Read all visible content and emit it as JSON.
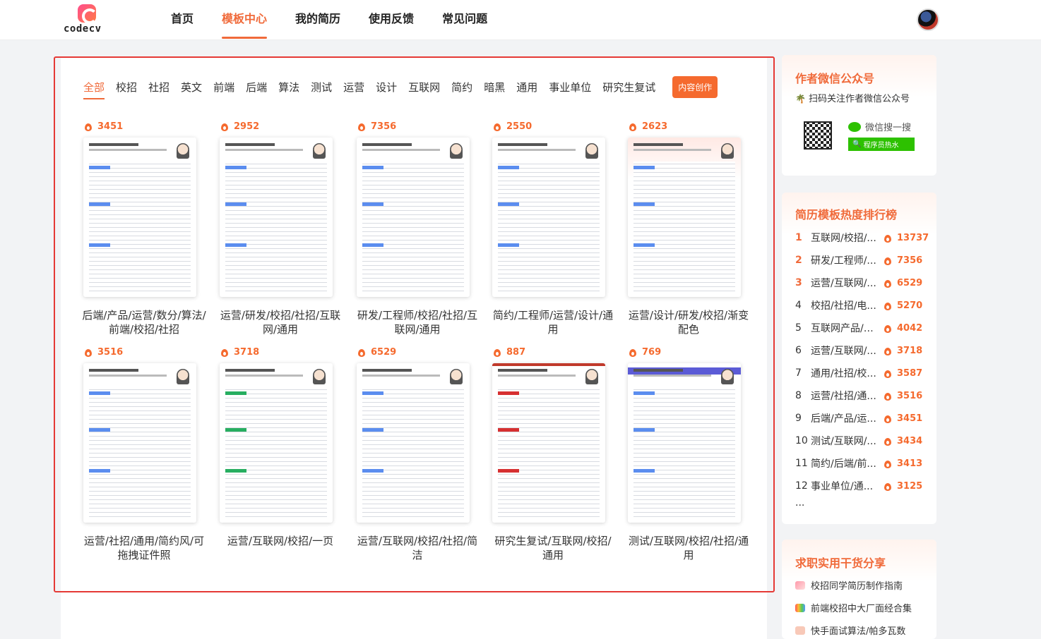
{
  "header": {
    "logo_text": "codecv",
    "nav": [
      "首页",
      "模板中心",
      "我的简历",
      "使用反馈",
      "常见问题"
    ],
    "active_nav": "模板中心"
  },
  "filters": {
    "tabs": [
      "全部",
      "校招",
      "社招",
      "英文",
      "前端",
      "后端",
      "算法",
      "测试",
      "运营",
      "设计",
      "互联网",
      "简约",
      "暗黑",
      "通用",
      "事业单位",
      "研究生复试"
    ],
    "active": "全部",
    "create_button": "内容创作"
  },
  "templates": [
    {
      "hot": "3451",
      "label": "后端/产品/运营/数分/算法/前端/校招/社招",
      "style": ""
    },
    {
      "hot": "2952",
      "label": "运营/研发/校招/社招/互联网/通用",
      "style": ""
    },
    {
      "hot": "7356",
      "label": "研发/工程师/校招/社招/互联网/通用",
      "style": ""
    },
    {
      "hot": "2550",
      "label": "简约/工程师/运营/设计/通用",
      "style": ""
    },
    {
      "hot": "2623",
      "label": "运营/设计/研发/校招/渐变配色",
      "style": "pinkbg"
    },
    {
      "hot": "3516",
      "label": "运营/社招/通用/简约风/可拖拽证件照",
      "style": ""
    },
    {
      "hot": "3718",
      "label": "运营/互联网/校招/一页",
      "style": "greensec"
    },
    {
      "hot": "6529",
      "label": "运营/互联网/校招/社招/简洁",
      "style": ""
    },
    {
      "hot": "887",
      "label": "研究生复试/互联网/校招/通用",
      "style": "redtop redsec"
    },
    {
      "hot": "769",
      "label": "测试/互联网/校招/社招/通用",
      "style": "bluebar"
    }
  ],
  "sidebar": {
    "wechat": {
      "title": "作者微信公众号",
      "desc": "扫码关注作者微信公众号",
      "search_text": "微信搜一搜",
      "button_text": "程序员热水"
    },
    "ranking": {
      "title": "简历模板热度排行榜",
      "items": [
        {
          "idx": "1",
          "name": "互联网/校招/...",
          "hot": "13737"
        },
        {
          "idx": "2",
          "name": "研发/工程师/...",
          "hot": "7356"
        },
        {
          "idx": "3",
          "name": "运营/互联网/...",
          "hot": "6529"
        },
        {
          "idx": "4",
          "name": "校招/社招/电...",
          "hot": "5270"
        },
        {
          "idx": "5",
          "name": "互联网产品/运...",
          "hot": "4042"
        },
        {
          "idx": "6",
          "name": "运营/互联网/...",
          "hot": "3718"
        },
        {
          "idx": "7",
          "name": "通用/社招/校...",
          "hot": "3587"
        },
        {
          "idx": "8",
          "name": "运营/社招/通...",
          "hot": "3516"
        },
        {
          "idx": "9",
          "name": "后端/产品/运...",
          "hot": "3451"
        },
        {
          "idx": "10",
          "name": "测试/互联网/...",
          "hot": "3434"
        },
        {
          "idx": "11",
          "name": "简约/后端/前...",
          "hot": "3413"
        },
        {
          "idx": "12",
          "name": "事业单位/通...",
          "hot": "3125"
        }
      ],
      "more": "..."
    },
    "share": {
      "title": "求职实用干货分享",
      "items": [
        "校招同学简历制作指南",
        "前端校招中大厂面经合集",
        "快手面试算法/帕多瓦数"
      ]
    }
  },
  "colors": {
    "accent": "#f06a3a",
    "highlight_border": "#e53935",
    "wechat_green": "#2dc100"
  }
}
